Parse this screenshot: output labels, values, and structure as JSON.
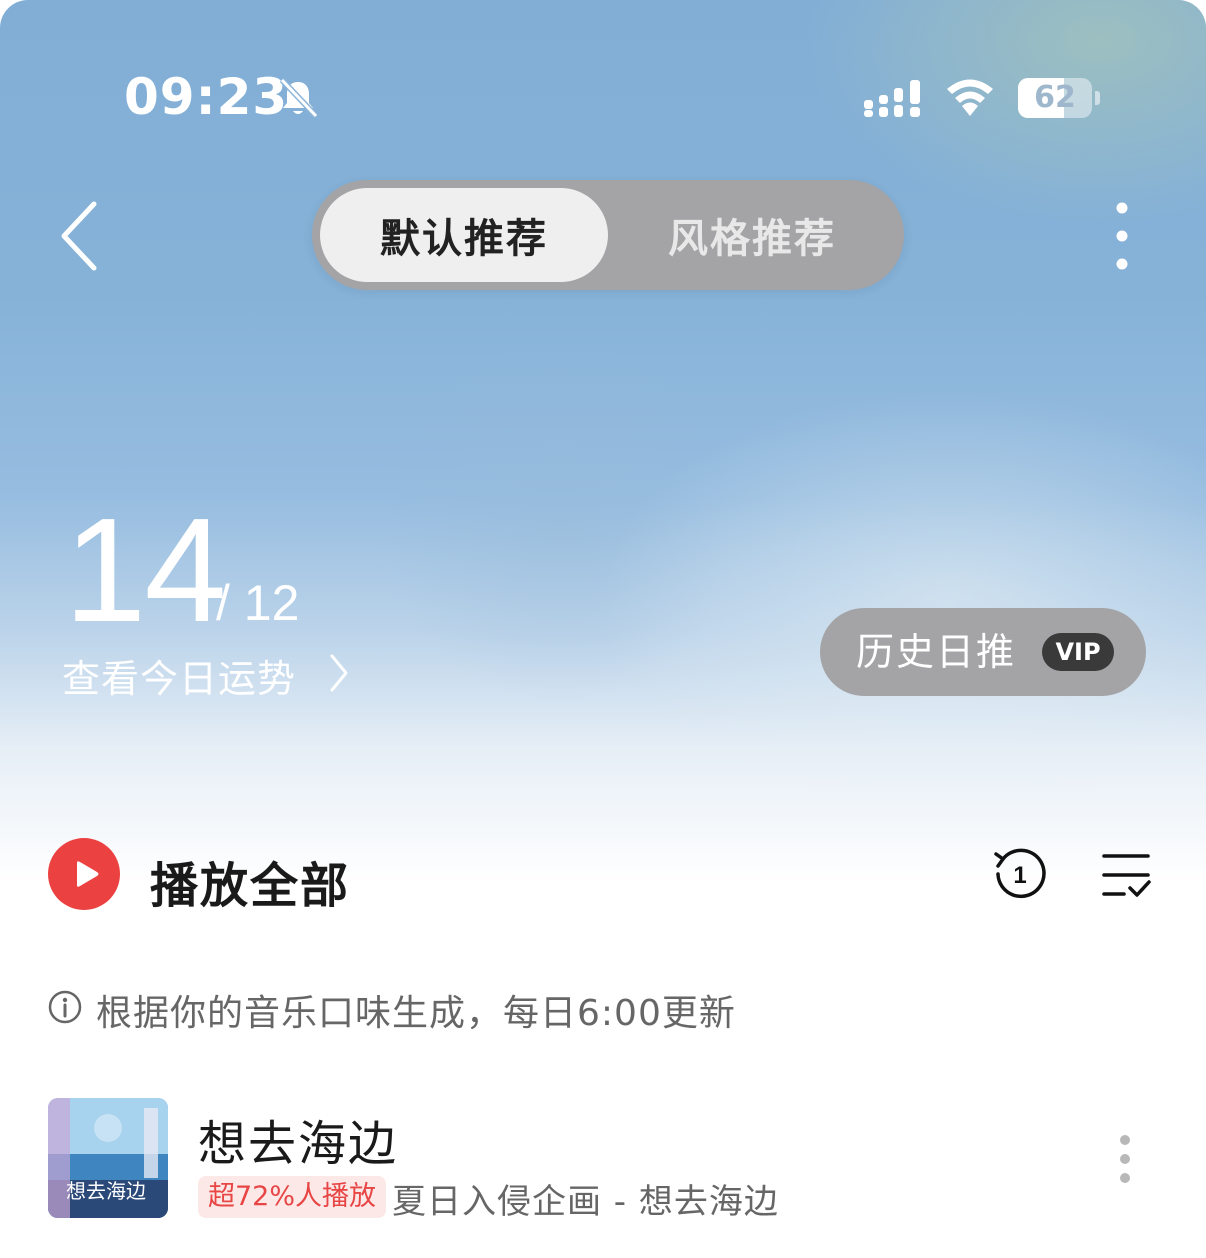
{
  "status_bar": {
    "time": "09:23",
    "mute_icon": "bell-slash-icon",
    "signal_icon": "signal-icon",
    "wifi_icon": "wifi-icon",
    "battery_percent": "62",
    "battery_level": 0.62
  },
  "nav": {
    "back_icon": "chevron-left-icon",
    "tabs": [
      {
        "label": "默认推荐",
        "active": true
      },
      {
        "label": "风格推荐",
        "active": false
      }
    ],
    "more_icon": "more-vertical-icon"
  },
  "date": {
    "day": "14",
    "month": "/ 12",
    "fortune_link": "查看今日运势"
  },
  "history_button": {
    "label": "历史日推",
    "badge": "VIP"
  },
  "play_all": {
    "label": "播放全部",
    "accent_color": "#ec4141",
    "history_icon": "replay-one-icon",
    "multi_select_icon": "list-check-icon"
  },
  "info": {
    "text": "根据你的音乐口味生成，每日6:00更新"
  },
  "songs": [
    {
      "title": "想去海边",
      "tag": "超72%人播放",
      "artist_album": "夏日入侵企画 - 想去海边",
      "cover_caption": "想去海边"
    }
  ]
}
